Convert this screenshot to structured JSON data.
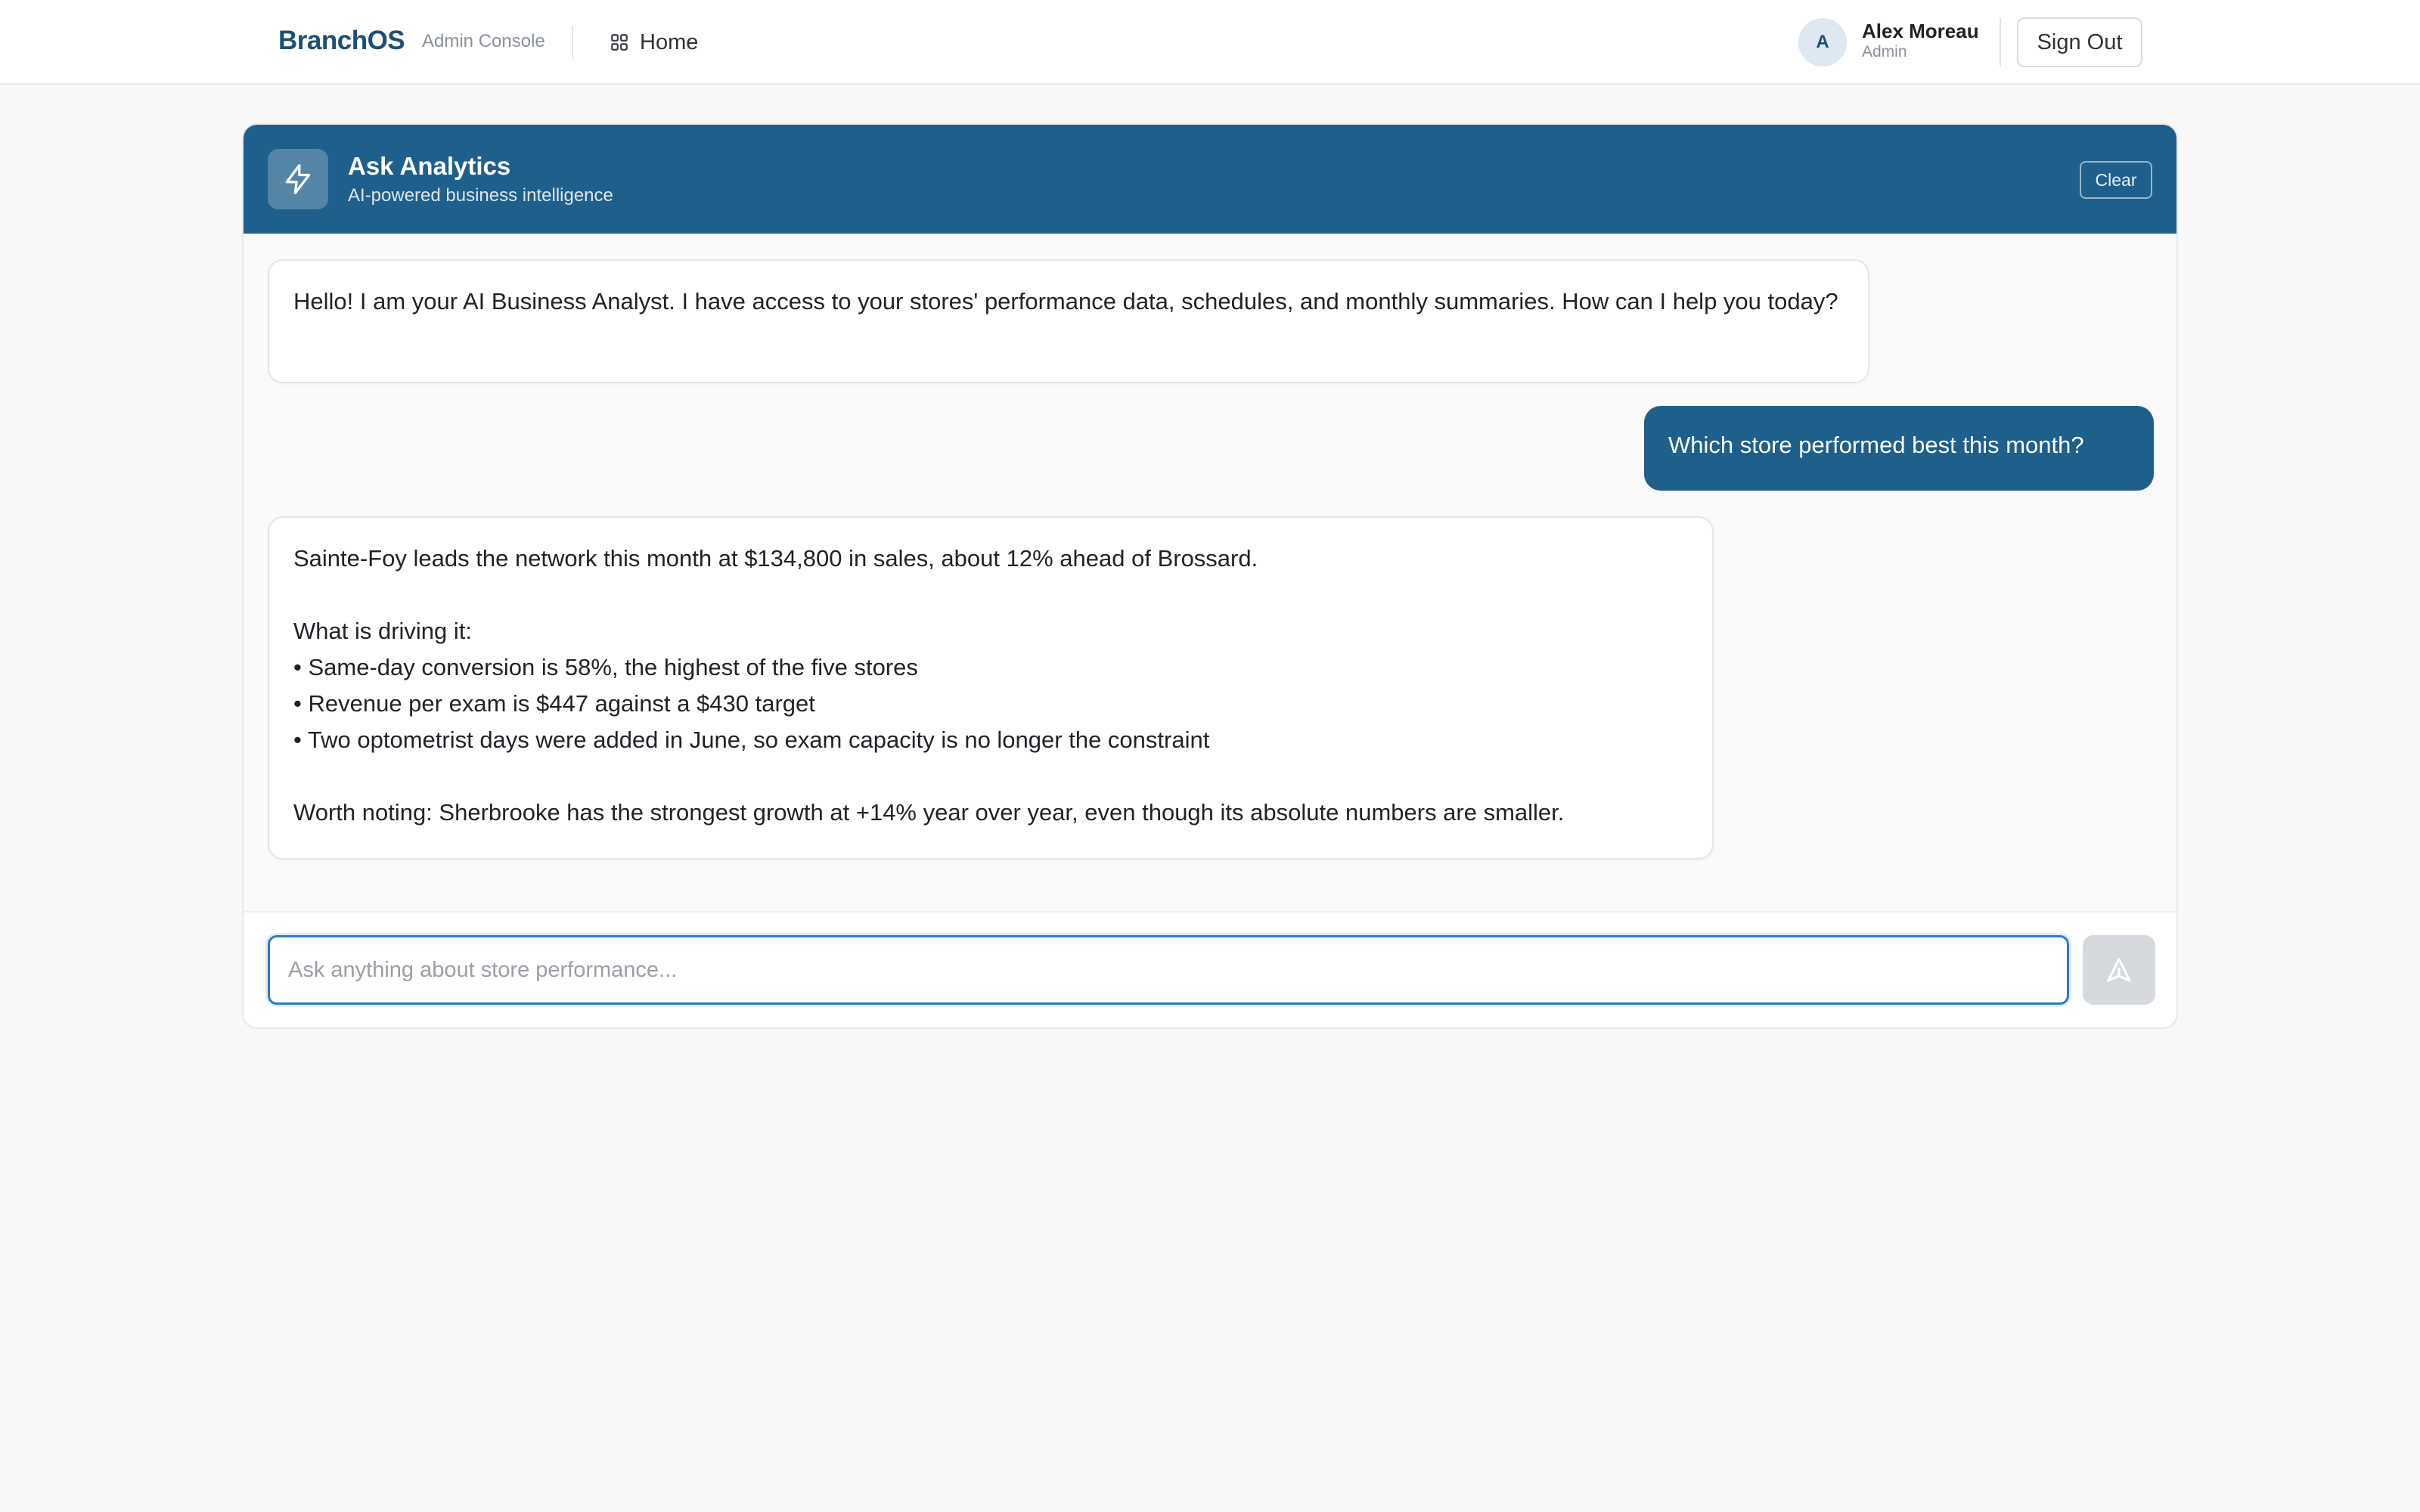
{
  "header": {
    "brand": "BranchOS",
    "brand_subtitle": "Admin Console",
    "nav_home_label": "Home",
    "user": {
      "initial": "A",
      "name": "Alex Moreau",
      "role": "Admin"
    },
    "signout_label": "Sign Out"
  },
  "chat": {
    "title": "Ask Analytics",
    "subtitle": "AI-powered business intelligence",
    "clear_label": "Clear",
    "messages": [
      {
        "role": "assistant",
        "text": "Hello! I am your AI Business Analyst. I have access to your stores' performance data, schedules, and monthly summaries. How can I help you today?"
      },
      {
        "role": "user",
        "text": "Which store performed best this month?"
      },
      {
        "role": "assistant",
        "text": "Sainte-Foy leads the network this month at $134,800 in sales, about 12% ahead of Brossard.\n\nWhat is driving it:\n• Same-day conversion is 58%, the highest of the five stores\n• Revenue per exam is $447 against a $430 target\n• Two optometrist days were added in June, so exam capacity is no longer the constraint\n\nWorth noting: Sherbrooke has the strongest growth at +14% year over year, even though its absolute numbers are smaller."
      }
    ],
    "input": {
      "value": "",
      "placeholder": "Ask anything about store performance..."
    }
  },
  "colors": {
    "brand": "#1d4f75",
    "header_bg": "#1f5f8b",
    "user_bubble": "#1f5f8b",
    "page_bg": "#f8f8f9",
    "input_focus": "#2f7bc0"
  },
  "icons": {
    "home": "grid-icon",
    "header": "lightning-bolt-icon",
    "send": "send-arrow-icon"
  }
}
